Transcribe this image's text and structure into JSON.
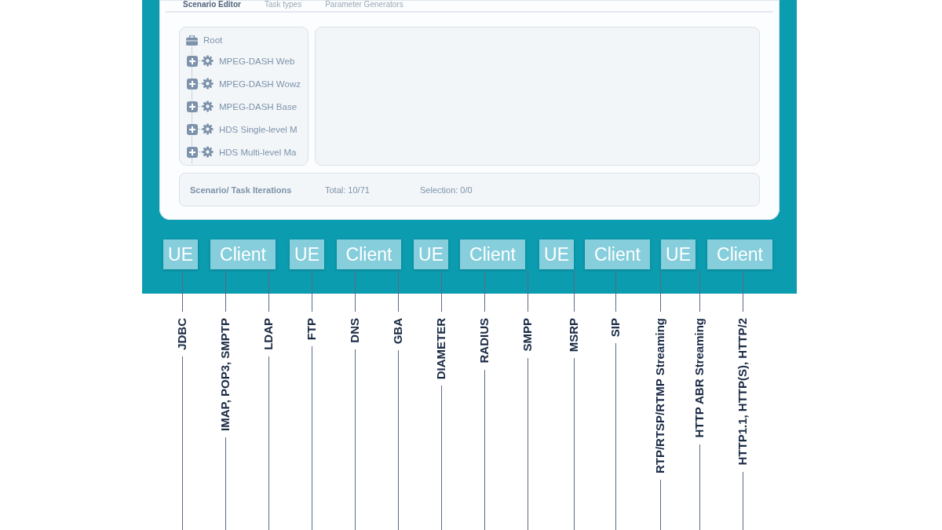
{
  "window": {
    "tabs": [
      {
        "label": "Scenario Editor",
        "selected": true
      },
      {
        "label": "Task types",
        "selected": false
      },
      {
        "label": "Parameter Generators",
        "selected": false
      }
    ],
    "tree": {
      "label": "Root",
      "children": [
        {
          "label": "MPEG-DASH Web",
          "expanded": false
        },
        {
          "label": "MPEG-DASH Wowz",
          "expanded": false
        },
        {
          "label": "MPEG-DASH Base",
          "expanded": false
        },
        {
          "label": "HDS Single-level M",
          "expanded": false
        },
        {
          "label": "HDS Multi-level Ma",
          "expanded": false
        }
      ]
    },
    "footer": {
      "title": "Scenario/ Task Iterations",
      "total": "Total: 10/71",
      "selection": "Selection: 0/0"
    }
  },
  "diagram": {
    "nodes": [
      "UE",
      "Client",
      "UE",
      "Client",
      "UE",
      "Client",
      "UE",
      "Client",
      "UE",
      "Client"
    ],
    "protocols": [
      "JDBC",
      "IMAP, POP3, SMPTP",
      "LDAP",
      "FTP",
      "DNS",
      "GBA",
      "DIAMETER",
      "RADIUS",
      "SMPP",
      "MSRP",
      "SIP",
      "RTP/RTSP/RTMP Streaming",
      "HTTP ABR Streaming",
      "HTTP1.1, HTTP(S), HTTP/2"
    ]
  }
}
